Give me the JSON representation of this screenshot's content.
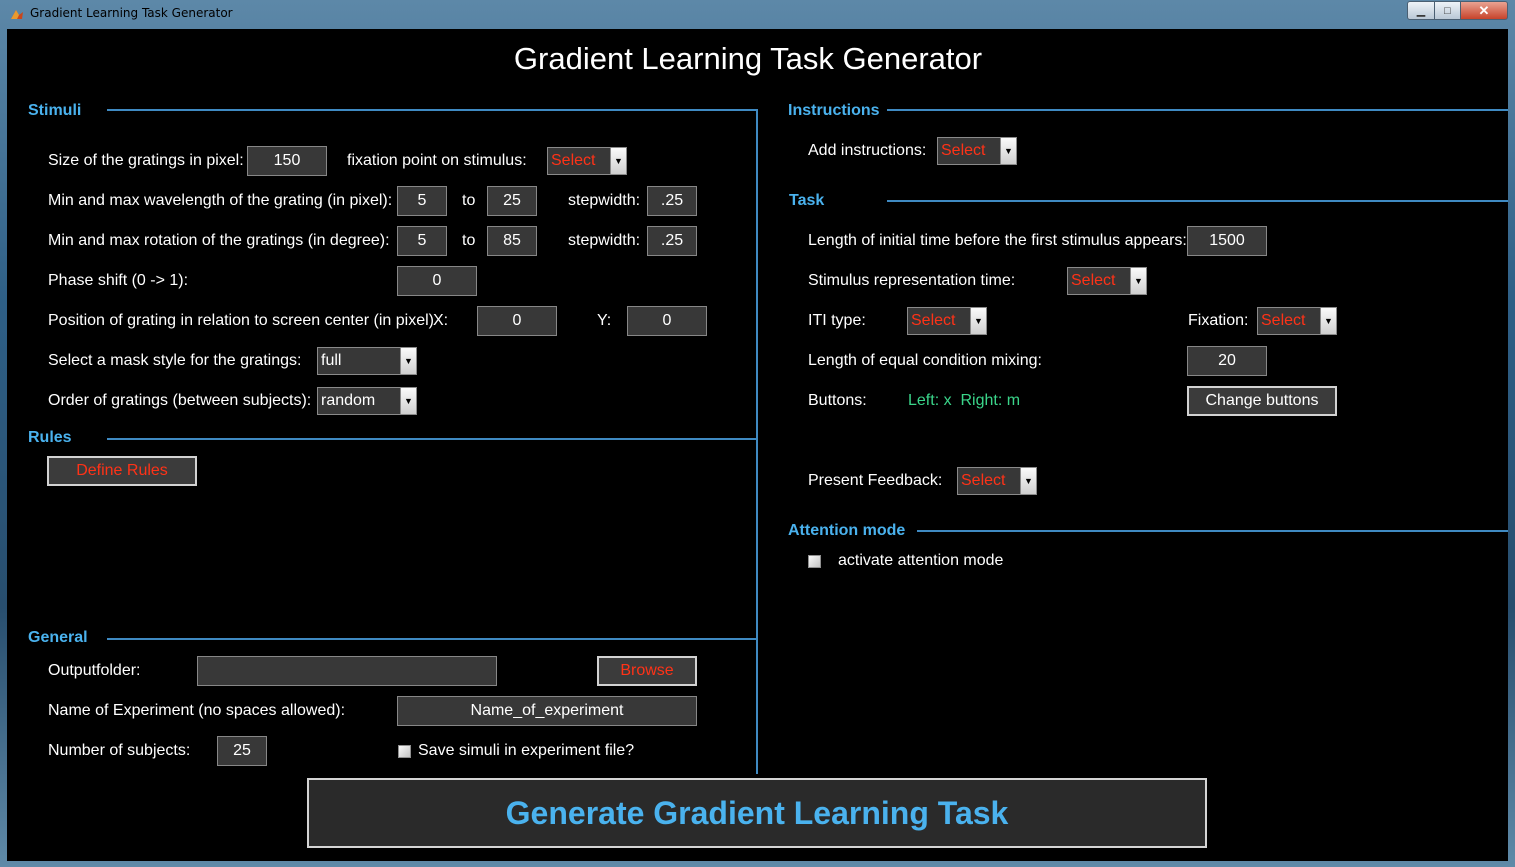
{
  "window": {
    "title": "Gradient Learning Task Generator",
    "min_glyph": "▁",
    "max_glyph": "□",
    "close_glyph": "✕"
  },
  "main_title": "Gradient Learning Task Generator",
  "stimuli": {
    "header": "Stimuli",
    "size_label": "Size of the gratings in pixel:",
    "size_value": "150",
    "fixation_label": "fixation point on stimulus:",
    "fixation_value": "Select",
    "wavelength_label": "Min and max wavelength of the grating (in pixel):",
    "wavelength_min": "5",
    "wavelength_to": "to",
    "wavelength_max": "25",
    "wavelength_step_label": "stepwidth:",
    "wavelength_step": ".25",
    "rotation_label": "Min and max rotation of the gratings (in degree):",
    "rotation_min": "5",
    "rotation_to": "to",
    "rotation_max": "85",
    "rotation_step_label": "stepwidth:",
    "rotation_step": ".25",
    "phase_label": "Phase shift (0 -> 1):",
    "phase_value": "0",
    "position_label": "Position of grating in relation to screen center (in pixel)",
    "x_label": "X:",
    "x_value": "0",
    "y_label": "Y:",
    "y_value": "0",
    "mask_label": "Select a mask style for the gratings:",
    "mask_value": "full",
    "order_label": "Order of gratings (between subjects):",
    "order_value": "random"
  },
  "rules": {
    "header": "Rules",
    "define_button": "Define Rules"
  },
  "general": {
    "header": "General",
    "output_label": "Outputfolder:",
    "output_value": "",
    "browse_button": "Browse",
    "name_label": "Name of Experiment (no spaces allowed):",
    "name_value": "Name_of_experiment",
    "subjects_label": "Number of subjects:",
    "subjects_value": "25",
    "save_label": "Save simuli in experiment file?"
  },
  "instructions": {
    "header": "Instructions",
    "add_label": "Add instructions:",
    "add_value": "Select"
  },
  "task": {
    "header": "Task",
    "initial_label": "Length of initial time before the first stimulus appears:",
    "initial_value": "1500",
    "representation_label": "Stimulus representation time:",
    "representation_value": "Select",
    "iti_label": "ITI type:",
    "iti_value": "Select",
    "fixation_label": "Fixation:",
    "fixation_value": "Select",
    "mixing_label": "Length of equal condition mixing:",
    "mixing_value": "20",
    "buttons_label": "Buttons:",
    "buttons_value": "Left: x  Right: m",
    "change_button": "Change buttons",
    "feedback_label": "Present Feedback:",
    "feedback_value": "Select"
  },
  "attention": {
    "header": "Attention mode",
    "activate_label": "activate attention mode"
  },
  "generate_button": "Generate Gradient Learning Task",
  "colors": {
    "accent": "#4ab2ee",
    "select_red": "#ff3217",
    "buttons_green": "#3ad58a",
    "panel_bg": "#000000"
  }
}
